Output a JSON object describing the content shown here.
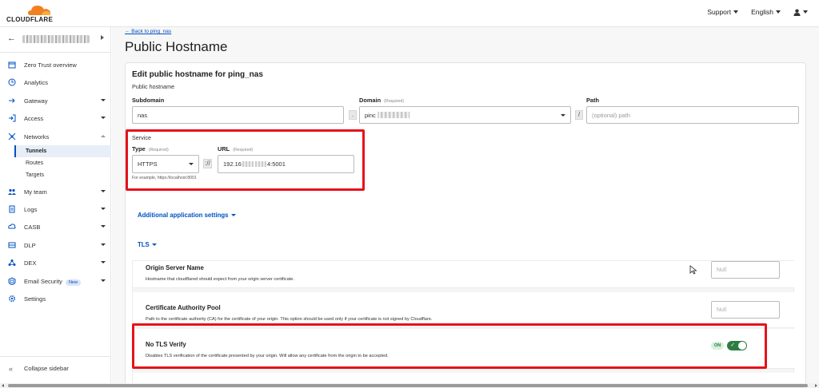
{
  "brand": {
    "name": "CLOUDFLARE",
    "accent": "#f38020"
  },
  "topnav": {
    "support": "Support",
    "language": "English"
  },
  "sidebar": {
    "items": [
      {
        "label": "Zero Trust overview",
        "icon": "calendar-icon"
      },
      {
        "label": "Analytics",
        "icon": "clock-icon"
      },
      {
        "label": "Gateway",
        "icon": "arrow-right-icon"
      },
      {
        "label": "Access",
        "icon": "login-icon"
      },
      {
        "label": "Networks",
        "icon": "network-icon"
      },
      {
        "label": "My team",
        "icon": "team-icon"
      },
      {
        "label": "Logs",
        "icon": "document-icon"
      },
      {
        "label": "CASB",
        "icon": "casb-icon"
      },
      {
        "label": "DLP",
        "icon": "dlp-icon"
      },
      {
        "label": "DEX",
        "icon": "dex-icon"
      },
      {
        "label": "Email Security",
        "icon": "email-icon",
        "badge": "New"
      },
      {
        "label": "Settings",
        "icon": "gear-icon"
      }
    ],
    "networks_sub": [
      "Tunnels",
      "Routes",
      "Targets"
    ],
    "collapse": "Collapse sidebar"
  },
  "main": {
    "back_link": "← Back to ping_nas",
    "title": "Public Hostname",
    "card_title": "Edit public hostname for ping_nas",
    "public_hostname_label": "Public hostname",
    "subdomain_label": "Subdomain",
    "subdomain_value": "nas",
    "domain_label": "Domain",
    "domain_required": "(Required)",
    "domain_value": "pinc",
    "path_label": "Path",
    "path_placeholder": "(optional) path",
    "dot_sep": ".",
    "slash_sep": "/",
    "service_label": "Service",
    "type_label": "Type",
    "type_required": "(Required)",
    "type_value": "HTTPS",
    "scheme_sep": "://",
    "url_label": "URL",
    "url_required": "(Required)",
    "url_value_start": "192.16",
    "url_value_end": "4:5001",
    "service_hint": "For example, https://localhost:8001",
    "additional_settings": "Additional application settings",
    "tls_label": "TLS",
    "tls_rows": [
      {
        "title": "Origin Server Name",
        "desc": "Hostname that cloudflared should expect from your origin server certificate.",
        "placeholder": "Null"
      },
      {
        "title": "Certificate Authority Pool",
        "desc": "Path to the certificate authority (CA) for the certificate of your origin. This option should be used only if your certificate is not signed by Cloudflare.",
        "placeholder": "Null"
      },
      {
        "title": "No TLS Verify",
        "desc": "Disables TLS verification of the certificate presented by your origin. Will allow any certificate from the origin to be accepted.",
        "toggle": "ON"
      }
    ]
  }
}
